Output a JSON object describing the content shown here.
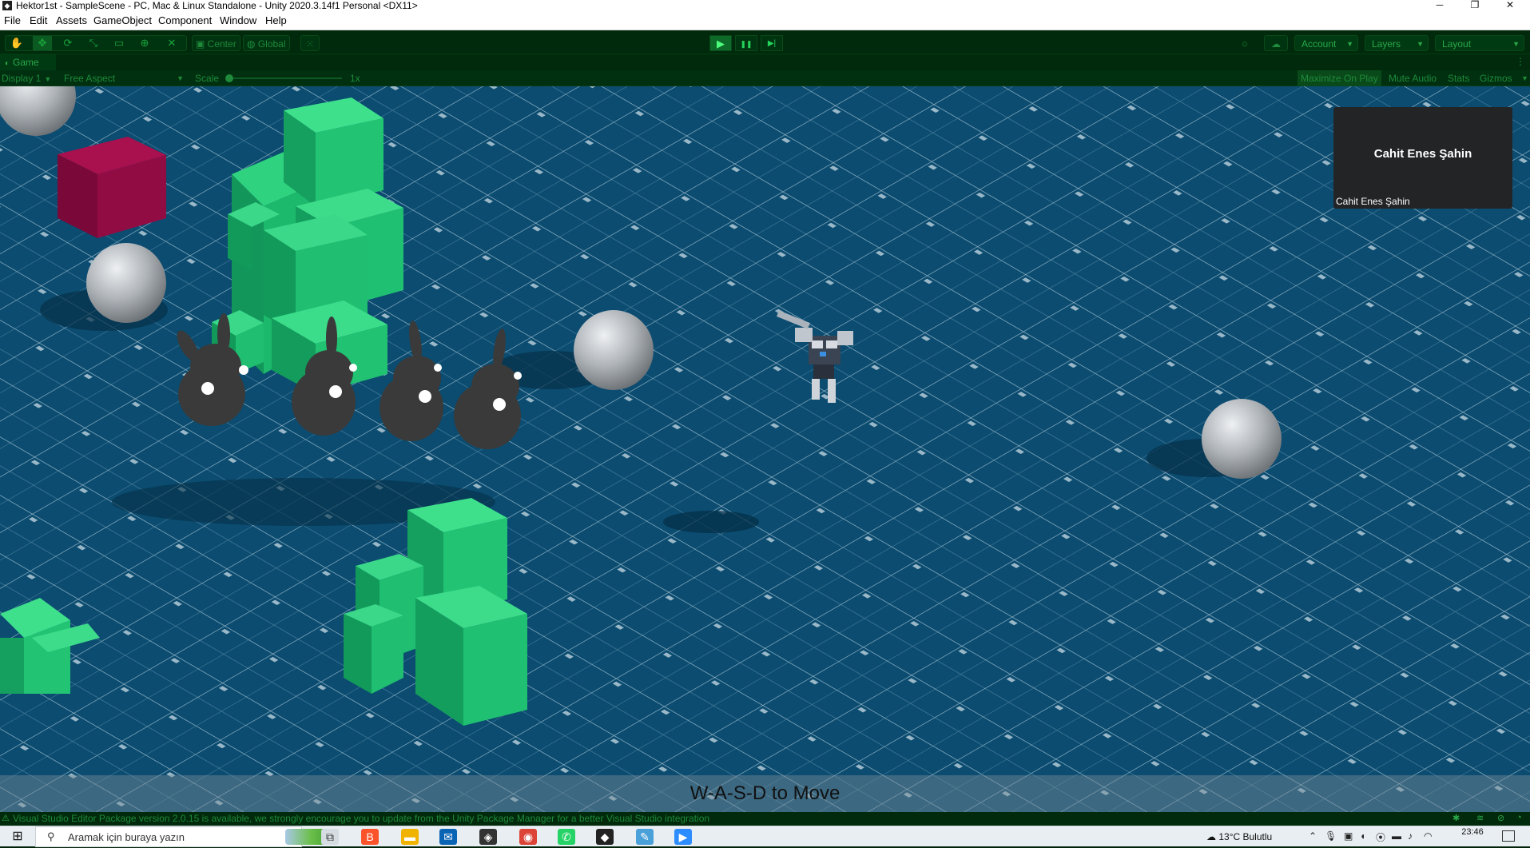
{
  "window": {
    "title": "Hektor1st - SampleScene - PC, Mac & Linux Standalone - Unity 2020.3.14f1 Personal <DX11>",
    "app_icon": "unity-icon",
    "minimize_glyph": "─",
    "maximize_glyph": "❐",
    "close_glyph": "✕"
  },
  "menu": [
    "File",
    "Edit",
    "Assets",
    "GameObject",
    "Component",
    "Window",
    "Help"
  ],
  "toolbar": {
    "tools": [
      {
        "icon": "hand-icon",
        "glyph": "✋"
      },
      {
        "icon": "move-icon",
        "glyph": "✥"
      },
      {
        "icon": "rotate-icon",
        "glyph": "⟳"
      },
      {
        "icon": "scale-icon",
        "glyph": "⤡"
      },
      {
        "icon": "rect-icon",
        "glyph": "▭"
      },
      {
        "icon": "transform-icon",
        "glyph": "⊕"
      },
      {
        "icon": "custom-tool-icon",
        "glyph": "✕"
      }
    ],
    "pivot_mode": "Center",
    "pivot_rotation": "Global",
    "snap_icon": "grid-snap-icon",
    "play_icon": "▶",
    "pause_icon": "❚❚",
    "step_icon": "▶|",
    "account_label": "Account",
    "layers_label": "Layers",
    "layout_label": "Layout"
  },
  "game_tab": {
    "label": "Game",
    "display": "Display 1",
    "aspect": "Free Aspect",
    "scale_label": "Scale",
    "scale_value": "1x",
    "toggles": [
      "Maximize On Play",
      "Mute Audio",
      "Stats",
      "Gizmos"
    ]
  },
  "viewport": {
    "hint": "W-A-S-D to Move",
    "overlay_name": "Cahit Enes Şahin",
    "overlay_label": "Cahit Enes Şahin",
    "floor_color": "#0a4a6e",
    "grid_color": "#cfe3ee",
    "block_color": "#19b866",
    "red_block_color": "#8a0a3e",
    "sphere_color": "#b8bcc0",
    "bunny_color": "#3a3a3a"
  },
  "status": {
    "text": "Visual Studio Editor Package version 2.0.15 is available, we strongly encourage you to update from the Unity Package Manager for a better Visual Studio integration"
  },
  "taskbar": {
    "search_placeholder": "Aramak için buraya yazın",
    "weather": "13°C  Bulutlu",
    "time": "23:46",
    "apps": [
      {
        "icon": "task-view-icon",
        "glyph": "⧉",
        "color": "#3a3a3a"
      },
      {
        "icon": "brave-icon",
        "glyph": "🦁",
        "color": "#fb542b"
      },
      {
        "icon": "file-explorer-icon",
        "glyph": "📁",
        "color": "#f0b400"
      },
      {
        "icon": "mail-icon",
        "glyph": "✉",
        "color": "#0a64b4"
      },
      {
        "icon": "unity-hub-icon",
        "glyph": "◈",
        "color": "#333333"
      },
      {
        "icon": "chrome-icon",
        "glyph": "◉",
        "color": "#db4437"
      },
      {
        "icon": "whatsapp-icon",
        "glyph": "✆",
        "color": "#25d366"
      },
      {
        "icon": "unity-icon",
        "glyph": "◆",
        "color": "#222222"
      },
      {
        "icon": "paint-icon",
        "glyph": "🎨",
        "color": "#4aa0d8"
      },
      {
        "icon": "zoom-icon",
        "glyph": "▶",
        "color": "#2d8cff"
      }
    ]
  }
}
